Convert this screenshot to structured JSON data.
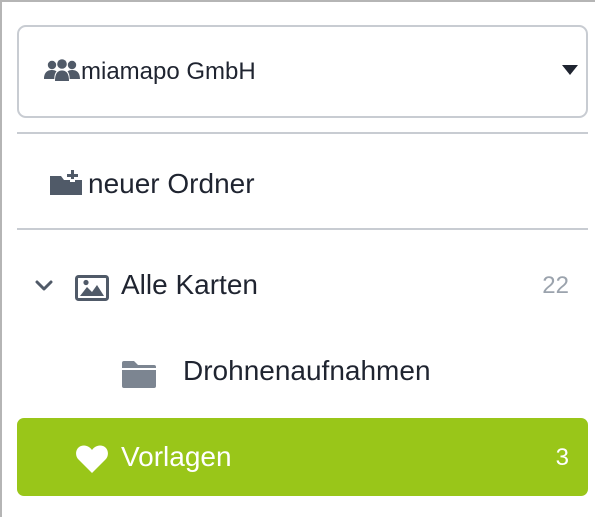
{
  "org_select": {
    "label": "miamapo GmbH",
    "icon": "users-icon",
    "caret_icon": "caret-down-icon"
  },
  "new_folder": {
    "label": "neuer Ordner",
    "icon": "folder-plus-icon"
  },
  "tree": {
    "all_maps": {
      "label": "Alle Karten",
      "count": "22",
      "expanded": true,
      "icon": "image-icon",
      "toggle_icon": "chevron-down-icon"
    },
    "drone": {
      "label": "Drohnenaufnahmen",
      "icon": "folder-icon"
    },
    "templates": {
      "label": "Vorlagen",
      "count": "3",
      "icon": "heart-icon",
      "active": true
    }
  },
  "colors": {
    "accent": "#99c619",
    "border": "#c8ccd2",
    "text": "#1f2430",
    "muted": "#9ba3ad",
    "icon": "#505a68"
  }
}
